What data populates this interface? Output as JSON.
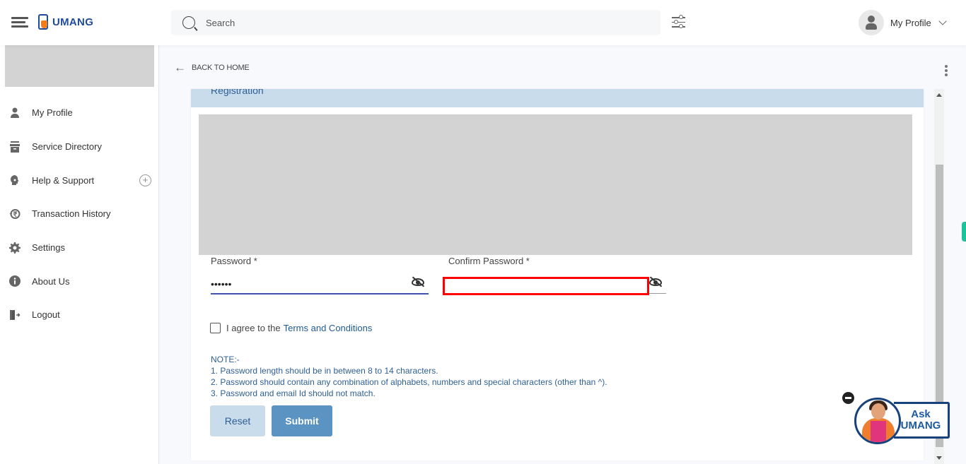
{
  "header": {
    "app_name": "UMANG",
    "search": {
      "placeholder": "Search",
      "value": ""
    },
    "profile_label": "My Profile"
  },
  "sidebar": {
    "items": [
      {
        "label": "My Profile",
        "icon": "user-icon"
      },
      {
        "label": "Service Directory",
        "icon": "archive-icon"
      },
      {
        "label": "Help & Support",
        "icon": "headset-icon",
        "expandable": true
      },
      {
        "label": "Transaction History",
        "icon": "rupee-history-icon"
      },
      {
        "label": "Settings",
        "icon": "gear-icon"
      },
      {
        "label": "About Us",
        "icon": "info-icon"
      },
      {
        "label": "Logout",
        "icon": "logout-icon"
      }
    ]
  },
  "main": {
    "back_label": "BACK TO HOME",
    "card_title": "Registration",
    "password": {
      "label": "Password *",
      "value": "••••••"
    },
    "confirm_password": {
      "label": "Confirm Password *",
      "value": ""
    },
    "agree_text": "I agree to the",
    "terms_link": "Terms and Conditions",
    "agree_checked": false,
    "notes": [
      "NOTE:-",
      "1. Password length should be in between 8 to 14 characters.",
      "2. Password should contain any combination of alphabets, numbers and special characters (other than ^).",
      "3. Password and email Id should not match."
    ],
    "reset_label": "Reset",
    "submit_label": "Submit"
  },
  "assistant": {
    "line1": "Ask",
    "line2": "UMANG"
  },
  "colors": {
    "brand_blue": "#1e4b9b",
    "brand_orange": "#f07c1b",
    "card_header_bg": "#c9dcec",
    "submit_bg": "#5b93c3",
    "active_underline": "#3f51b5",
    "highlight_red": "#ff0000"
  }
}
